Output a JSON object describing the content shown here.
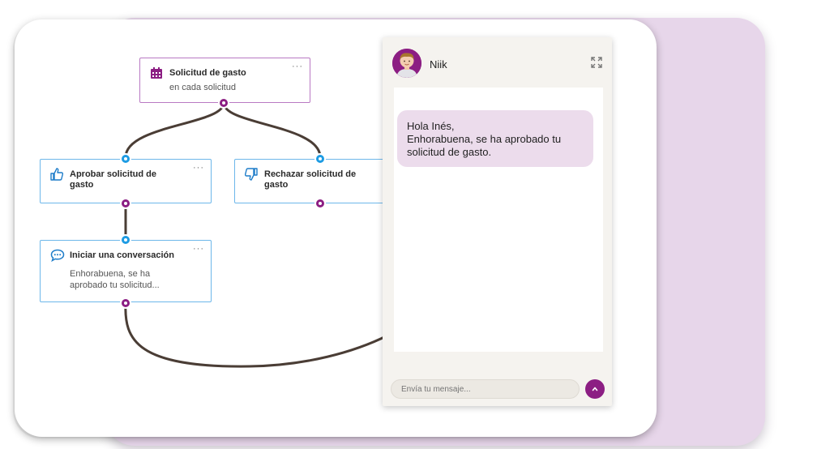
{
  "flow": {
    "trigger": {
      "title": "Solicitud de gasto",
      "subtitle": "en cada solicitud",
      "icon": "calendar-icon",
      "menu": "···"
    },
    "approve": {
      "title_line1": "Aprobar solicitud de",
      "title_line2": "gasto",
      "icon": "thumbs-up-icon",
      "menu": "···"
    },
    "reject": {
      "title_line1": "Rechazar solicitud de",
      "title_line2": "gasto",
      "icon": "thumbs-down-icon"
    },
    "conversation": {
      "title": "Iniciar una conversación",
      "subtitle_line1": "Enhorabuena, se ha",
      "subtitle_line2": "aprobado tu solicitud...",
      "icon": "chat-bubble-icon",
      "menu": "···"
    }
  },
  "chat": {
    "bot_name": "Niik",
    "message": [
      "Hola Inés,",
      "Enhorabuena, se ha aprobado tu",
      "solicitud de gasto."
    ],
    "input_placeholder": "Envía tu mensaje...",
    "send_icon": "arrow-up-icon",
    "expand_icon": "expand-icon"
  },
  "colors": {
    "accent": "#8c1e83",
    "input_port": "#1d9be3",
    "node_border": "#6db7ea",
    "trigger_border": "#b979c3",
    "connector": "#4a3d35",
    "bubble": "#ecdcec",
    "background_card": "#e7d6ea"
  }
}
